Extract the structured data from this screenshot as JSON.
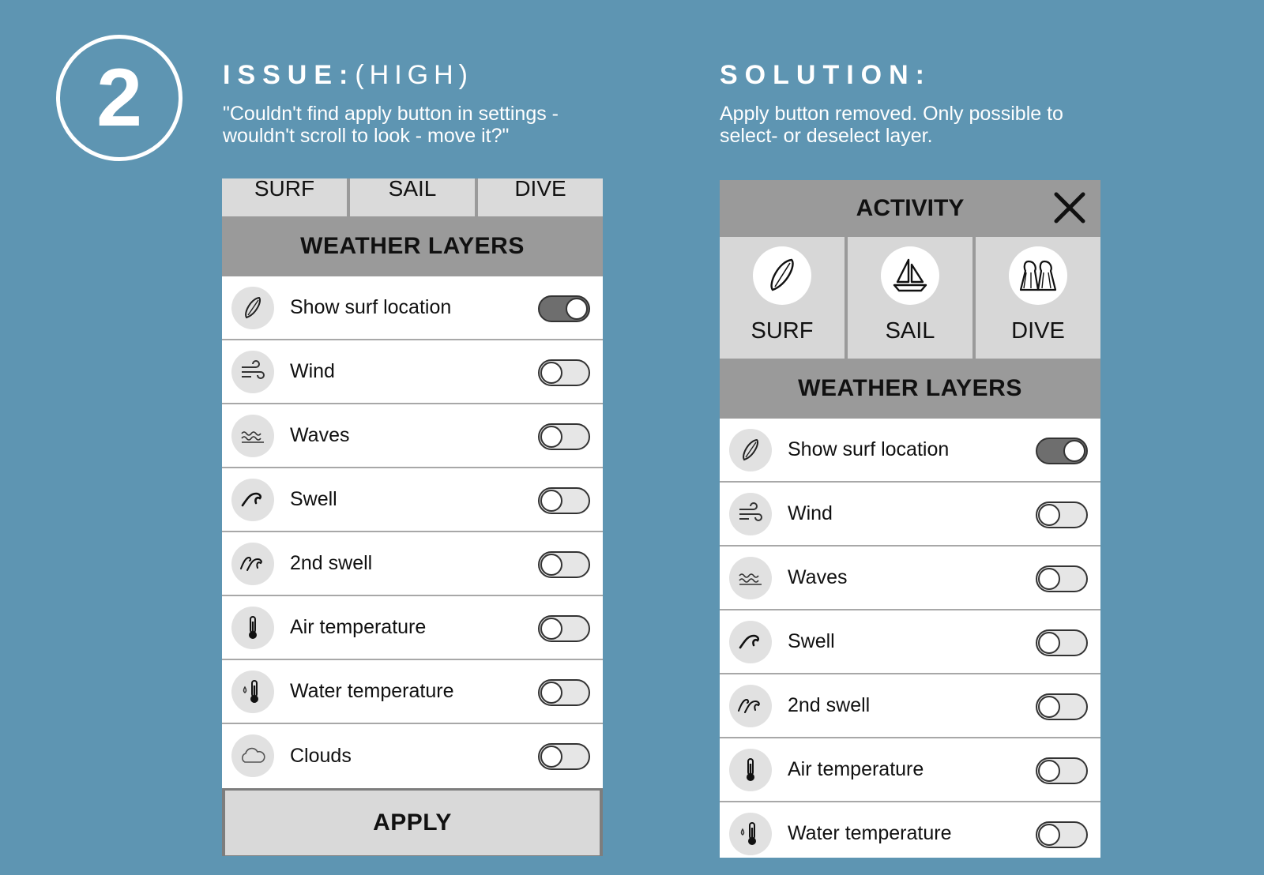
{
  "step_number": "2",
  "issue": {
    "title": "ISSUE:",
    "severity": "(HIGH)",
    "quote_line1": "\"Couldn't find apply button in settings -",
    "quote_line2": "wouldn't scroll to look - move it?\""
  },
  "solution": {
    "title": "SOLUTION:",
    "text_line1": "Apply button removed. Only possible to",
    "text_line2": "select- or deselect layer."
  },
  "before_screen": {
    "tabs": [
      "SURF",
      "SAIL",
      "DIVE"
    ],
    "section_title": "WEATHER LAYERS",
    "layers": [
      {
        "label": "Show surf location",
        "icon": "surfboard-icon",
        "enabled": true
      },
      {
        "label": "Wind",
        "icon": "wind-icon",
        "enabled": false
      },
      {
        "label": "Waves",
        "icon": "waves-icon",
        "enabled": false
      },
      {
        "label": "Swell",
        "icon": "swell-icon",
        "enabled": false
      },
      {
        "label": "2nd swell",
        "icon": "second-swell-icon",
        "enabled": false
      },
      {
        "label": "Air temperature",
        "icon": "thermometer-icon",
        "enabled": false
      },
      {
        "label": "Water temperature",
        "icon": "water-thermometer-icon",
        "enabled": false
      },
      {
        "label": "Clouds",
        "icon": "cloud-icon",
        "enabled": false
      }
    ],
    "apply_label": "APPLY"
  },
  "after_screen": {
    "header_title": "ACTIVITY",
    "activities": [
      {
        "label": "SURF",
        "icon": "surfboard-icon"
      },
      {
        "label": "SAIL",
        "icon": "sailboat-icon"
      },
      {
        "label": "DIVE",
        "icon": "flippers-icon"
      }
    ],
    "section_title": "WEATHER LAYERS",
    "layers": [
      {
        "label": "Show surf location",
        "icon": "surfboard-icon",
        "enabled": true
      },
      {
        "label": "Wind",
        "icon": "wind-icon",
        "enabled": false
      },
      {
        "label": "Waves",
        "icon": "waves-icon",
        "enabled": false
      },
      {
        "label": "Swell",
        "icon": "swell-icon",
        "enabled": false
      },
      {
        "label": "2nd swell",
        "icon": "second-swell-icon",
        "enabled": false
      },
      {
        "label": "Air temperature",
        "icon": "thermometer-icon",
        "enabled": false
      },
      {
        "label": "Water temperature",
        "icon": "water-thermometer-icon",
        "enabled": false
      }
    ]
  },
  "colors": {
    "background": "#5e95b2",
    "panel_header": "#9a9a9a",
    "tab": "#dadada",
    "toggle_on": "#6e6e6e"
  }
}
